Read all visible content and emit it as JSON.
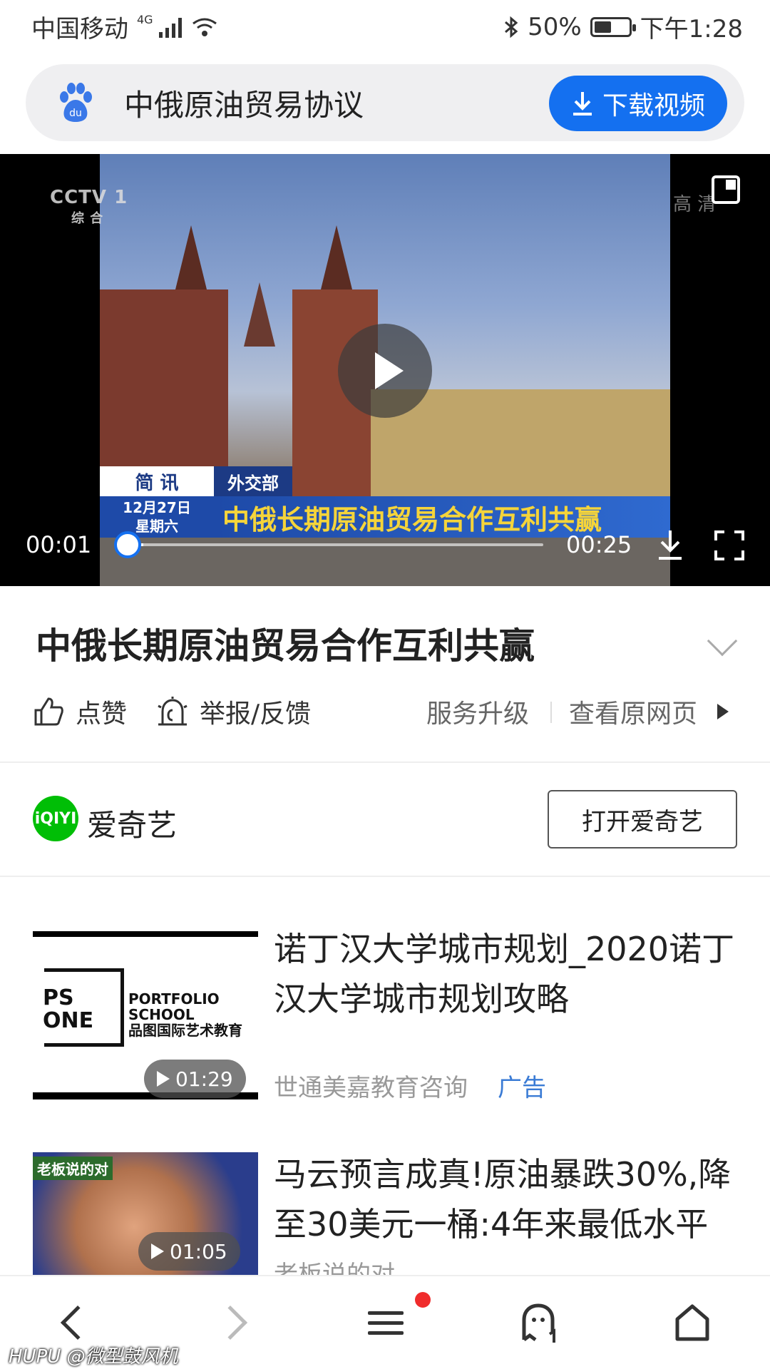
{
  "status_bar": {
    "carrier": "中国移动",
    "network": "4G",
    "battery_percent": "50%",
    "battery_level": 0.5,
    "time": "下午1:28"
  },
  "search": {
    "query": "中俄原油贸易协议",
    "download_button": "下载视频",
    "logo_text": "du"
  },
  "video": {
    "channel_logo": "CCTV 1",
    "channel_sub": "综 合",
    "quality_badge": "高 清",
    "caption_tag": "简 讯",
    "caption_section": "外交部",
    "caption_date_line1": "12月27日",
    "caption_date_line2": "星期六",
    "caption_headline": "中俄长期原油贸易合作互利共赢",
    "current_time": "00:01",
    "duration": "00:25",
    "progress": 0.04
  },
  "title": "中俄长期原油贸易合作互利共赢",
  "actions": {
    "like": "点赞",
    "report": "举报/反馈",
    "upgrade": "服务升级",
    "view_original": "查看原网页"
  },
  "source": {
    "logo_text": "iQIYI",
    "name": "爱奇艺",
    "open_button": "打开爱奇艺"
  },
  "feed": [
    {
      "title": "诺丁汉大学城市规划_2020诺丁汉大学城市规划攻略",
      "duration": "01:29",
      "source": "世通美嘉教育咨询",
      "ad_label": "广告",
      "thumb_text_main": "PS\nONE",
      "thumb_text_side": "PORTFOLIO\nSCHOOL\n品图国际艺术教育"
    },
    {
      "title": "马云预言成真!原油暴跌30%,降至30美元一桶:4年来最低水平",
      "duration": "01:05",
      "source": "老板说的对",
      "thumb_tag": "老板说的对"
    }
  ],
  "watermark": "HUPU @微型鼓风机"
}
